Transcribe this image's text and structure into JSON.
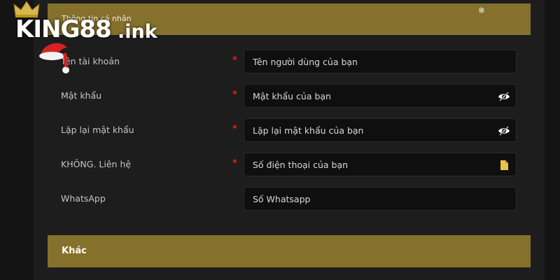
{
  "logo": {
    "brand": "KING88",
    "suffix": ".ink"
  },
  "sections": {
    "personal": "Thông tin cá nhân",
    "other": "Khác"
  },
  "form": {
    "rows": [
      {
        "label": "Tên tài khoản",
        "required": "*",
        "placeholder": "Tên người dùng của bạn",
        "icon": ""
      },
      {
        "label": "Mật khẩu",
        "required": "*",
        "placeholder": "Mật khẩu của bạn",
        "icon": "eye-toggle-icon"
      },
      {
        "label": "Lặp lại mật khẩu",
        "required": "*",
        "placeholder": "Lặp lại mật khẩu của bạn",
        "icon": "eye-toggle-icon"
      },
      {
        "label": "KHÔNG. Liên hệ",
        "required": "*",
        "placeholder": "Số điện thoại của bạn",
        "icon": "document-icon"
      },
      {
        "label": "WhatsApp",
        "required": "",
        "placeholder": "Số Whatsapp",
        "icon": ""
      }
    ]
  },
  "colors": {
    "accent_gold": "#85712b",
    "required_red": "#e02020",
    "background": "#141414",
    "field_bg": "#0f0f0f"
  }
}
